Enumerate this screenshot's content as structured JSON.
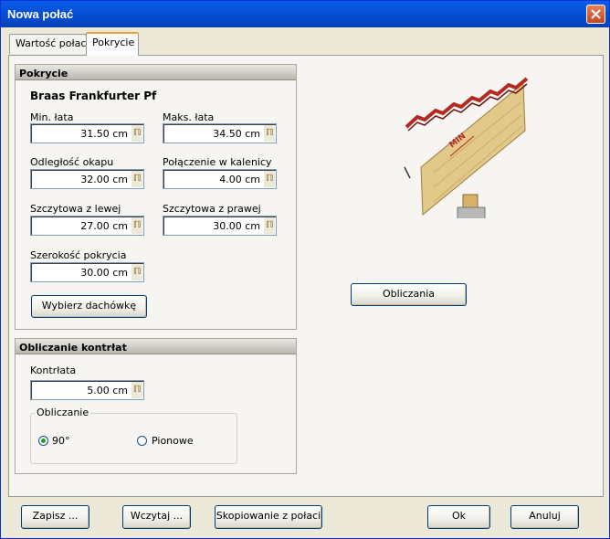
{
  "window": {
    "title": "Nowa połać"
  },
  "tabs": [
    {
      "label": "Wartość połaci"
    },
    {
      "label": "Pokrycie"
    }
  ],
  "covering": {
    "header": "Pokrycie",
    "product": "Braas Frankfurter Pf",
    "min_lath_label": "Min. łata",
    "min_lath_value": "31.50 cm",
    "max_lath_label": "Maks. łata",
    "max_lath_value": "34.50 cm",
    "eave_distance_label": "Odległość okapu",
    "eave_distance_value": "32.00 cm",
    "ridge_joint_label": "Połączenie w kalenicy",
    "ridge_joint_value": "4.00 cm",
    "gable_left_label": "Szczytowa z lewej",
    "gable_left_value": "27.00 cm",
    "gable_right_label": "Szczytowa z prawej",
    "gable_right_value": "30.00 cm",
    "width_label": "Szerokość pokrycia",
    "width_value": "30.00 cm",
    "choose_tile_button": "Wybierz dachówkę"
  },
  "counter_lath": {
    "header": "Obliczanie kontrłat",
    "counter_lath_label": "Kontrłata",
    "counter_lath_value": "5.00 cm",
    "calc_legend": "Obliczanie",
    "option_90": "90°",
    "option_vertical": "Pionowe",
    "selected": "90°"
  },
  "diagram": {
    "min_label": "MIN"
  },
  "calculate_button": "Obliczania",
  "footer": {
    "save": "Zapisz ...",
    "load": "Wczytaj ...",
    "copy": "Skopiowanie z połaci",
    "ok": "Ok",
    "cancel": "Anuluj"
  },
  "colors": {
    "titlebar": "#0a5ee8",
    "tab_accent": "#e8a33d",
    "wood": "#e2c98a",
    "tile": "#b32a22"
  }
}
